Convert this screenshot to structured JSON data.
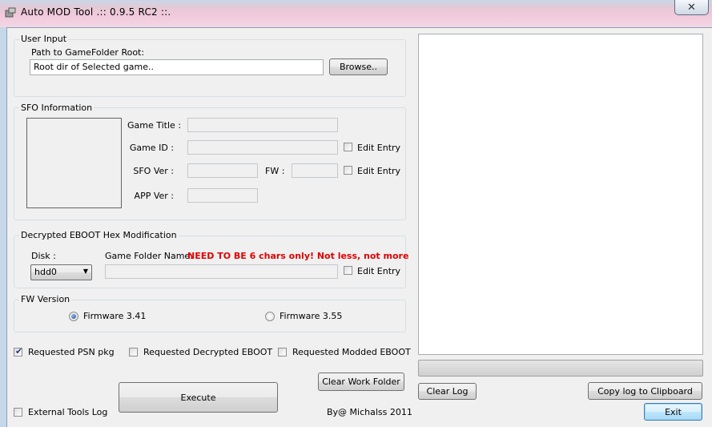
{
  "window": {
    "title": "Auto MOD Tool .:: 0.9.5 RC2 ::.",
    "close_label": "✕"
  },
  "user_input": {
    "group_label": "User Input",
    "path_label": "Path to GameFolder Root:",
    "path_value": "Root dir of Selected game..",
    "browse_label": "Browse.."
  },
  "sfo": {
    "group_label": "SFO Information",
    "game_title_label": "Game Title :",
    "game_title_value": "",
    "game_id_label": "Game ID :",
    "game_id_value": "",
    "sfo_ver_label": "SFO Ver :",
    "sfo_ver_value": "",
    "fw_label": "FW :",
    "fw_value": "",
    "app_ver_label": "APP Ver :",
    "app_ver_value": "",
    "edit_entry_label": "Edit Entry"
  },
  "eboot": {
    "group_label": "Decrypted EBOOT Hex Modification",
    "disk_label": "Disk :",
    "disk_value": "hdd0",
    "game_folder_label": "Game Folder Name:",
    "warning": "NEED TO BE 6 chars only! Not less, not more",
    "folder_value": "",
    "edit_entry_label": "Edit Entry"
  },
  "fw_version": {
    "group_label": "FW Version",
    "option_341": "Firmware 3.41",
    "option_355": "Firmware 3.55",
    "selected": "Firmware 3.41"
  },
  "requests": {
    "psn_pkg_label": "Requested PSN pkg",
    "psn_pkg_checked": true,
    "decrypted_eboot_label": "Requested Decrypted EBOOT",
    "modded_eboot_label": "Requested Modded EBOOT"
  },
  "actions": {
    "clear_work_folder": "Clear Work Folder",
    "execute": "Execute",
    "external_tools_log": "External Tools Log",
    "credit": "By@ Michalss 2011",
    "clear_log": "Clear Log",
    "copy_log": "Copy log to Clipboard",
    "exit": "Exit"
  },
  "log": {
    "progress_percent": 0
  }
}
